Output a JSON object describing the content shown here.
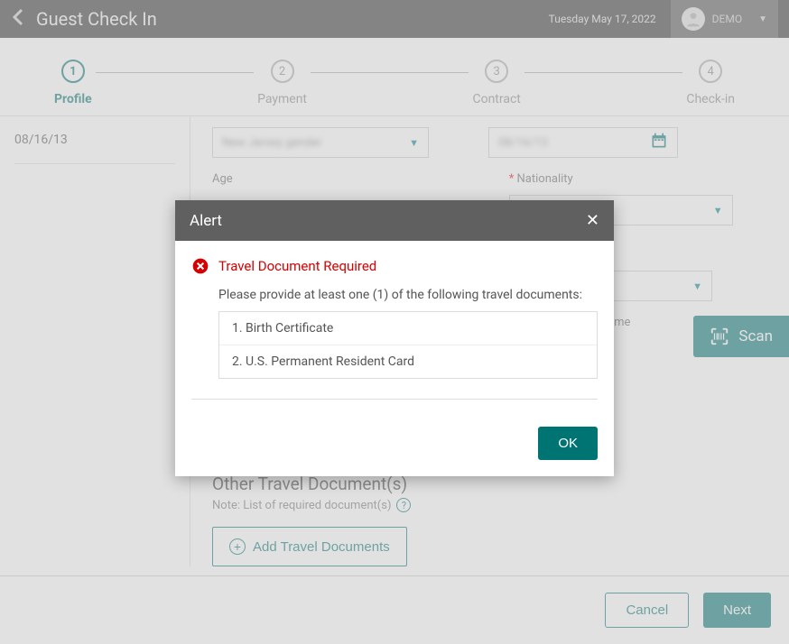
{
  "header": {
    "title": "Guest Check In",
    "date": "Tuesday May 17, 2022",
    "user": "DEMO"
  },
  "stepper": {
    "steps": [
      {
        "num": "1",
        "label": "Profile"
      },
      {
        "num": "2",
        "label": "Payment"
      },
      {
        "num": "3",
        "label": "Contract"
      },
      {
        "num": "4",
        "label": "Check-in"
      }
    ]
  },
  "sidebar": {
    "date": "08/16/13"
  },
  "form": {
    "age_label": "Age",
    "nationality_label": "Nationality",
    "selector_blurred": "New Jersey gender",
    "date_blurred": "08/16/13",
    "name_suffix": "ame",
    "section_title": "Other Travel Document(s)",
    "section_note": "Note: List of required document(s)",
    "add_btn": "Add Travel Documents"
  },
  "scan": {
    "label": "Scan"
  },
  "footer": {
    "cancel": "Cancel",
    "next": "Next"
  },
  "modal": {
    "header": "Alert",
    "title": "Travel Document Required",
    "message": "Please provide at least one (1) of the following travel documents:",
    "documents": [
      "1. Birth Certificate",
      "2. U.S. Permanent Resident Card"
    ],
    "ok": "OK"
  }
}
